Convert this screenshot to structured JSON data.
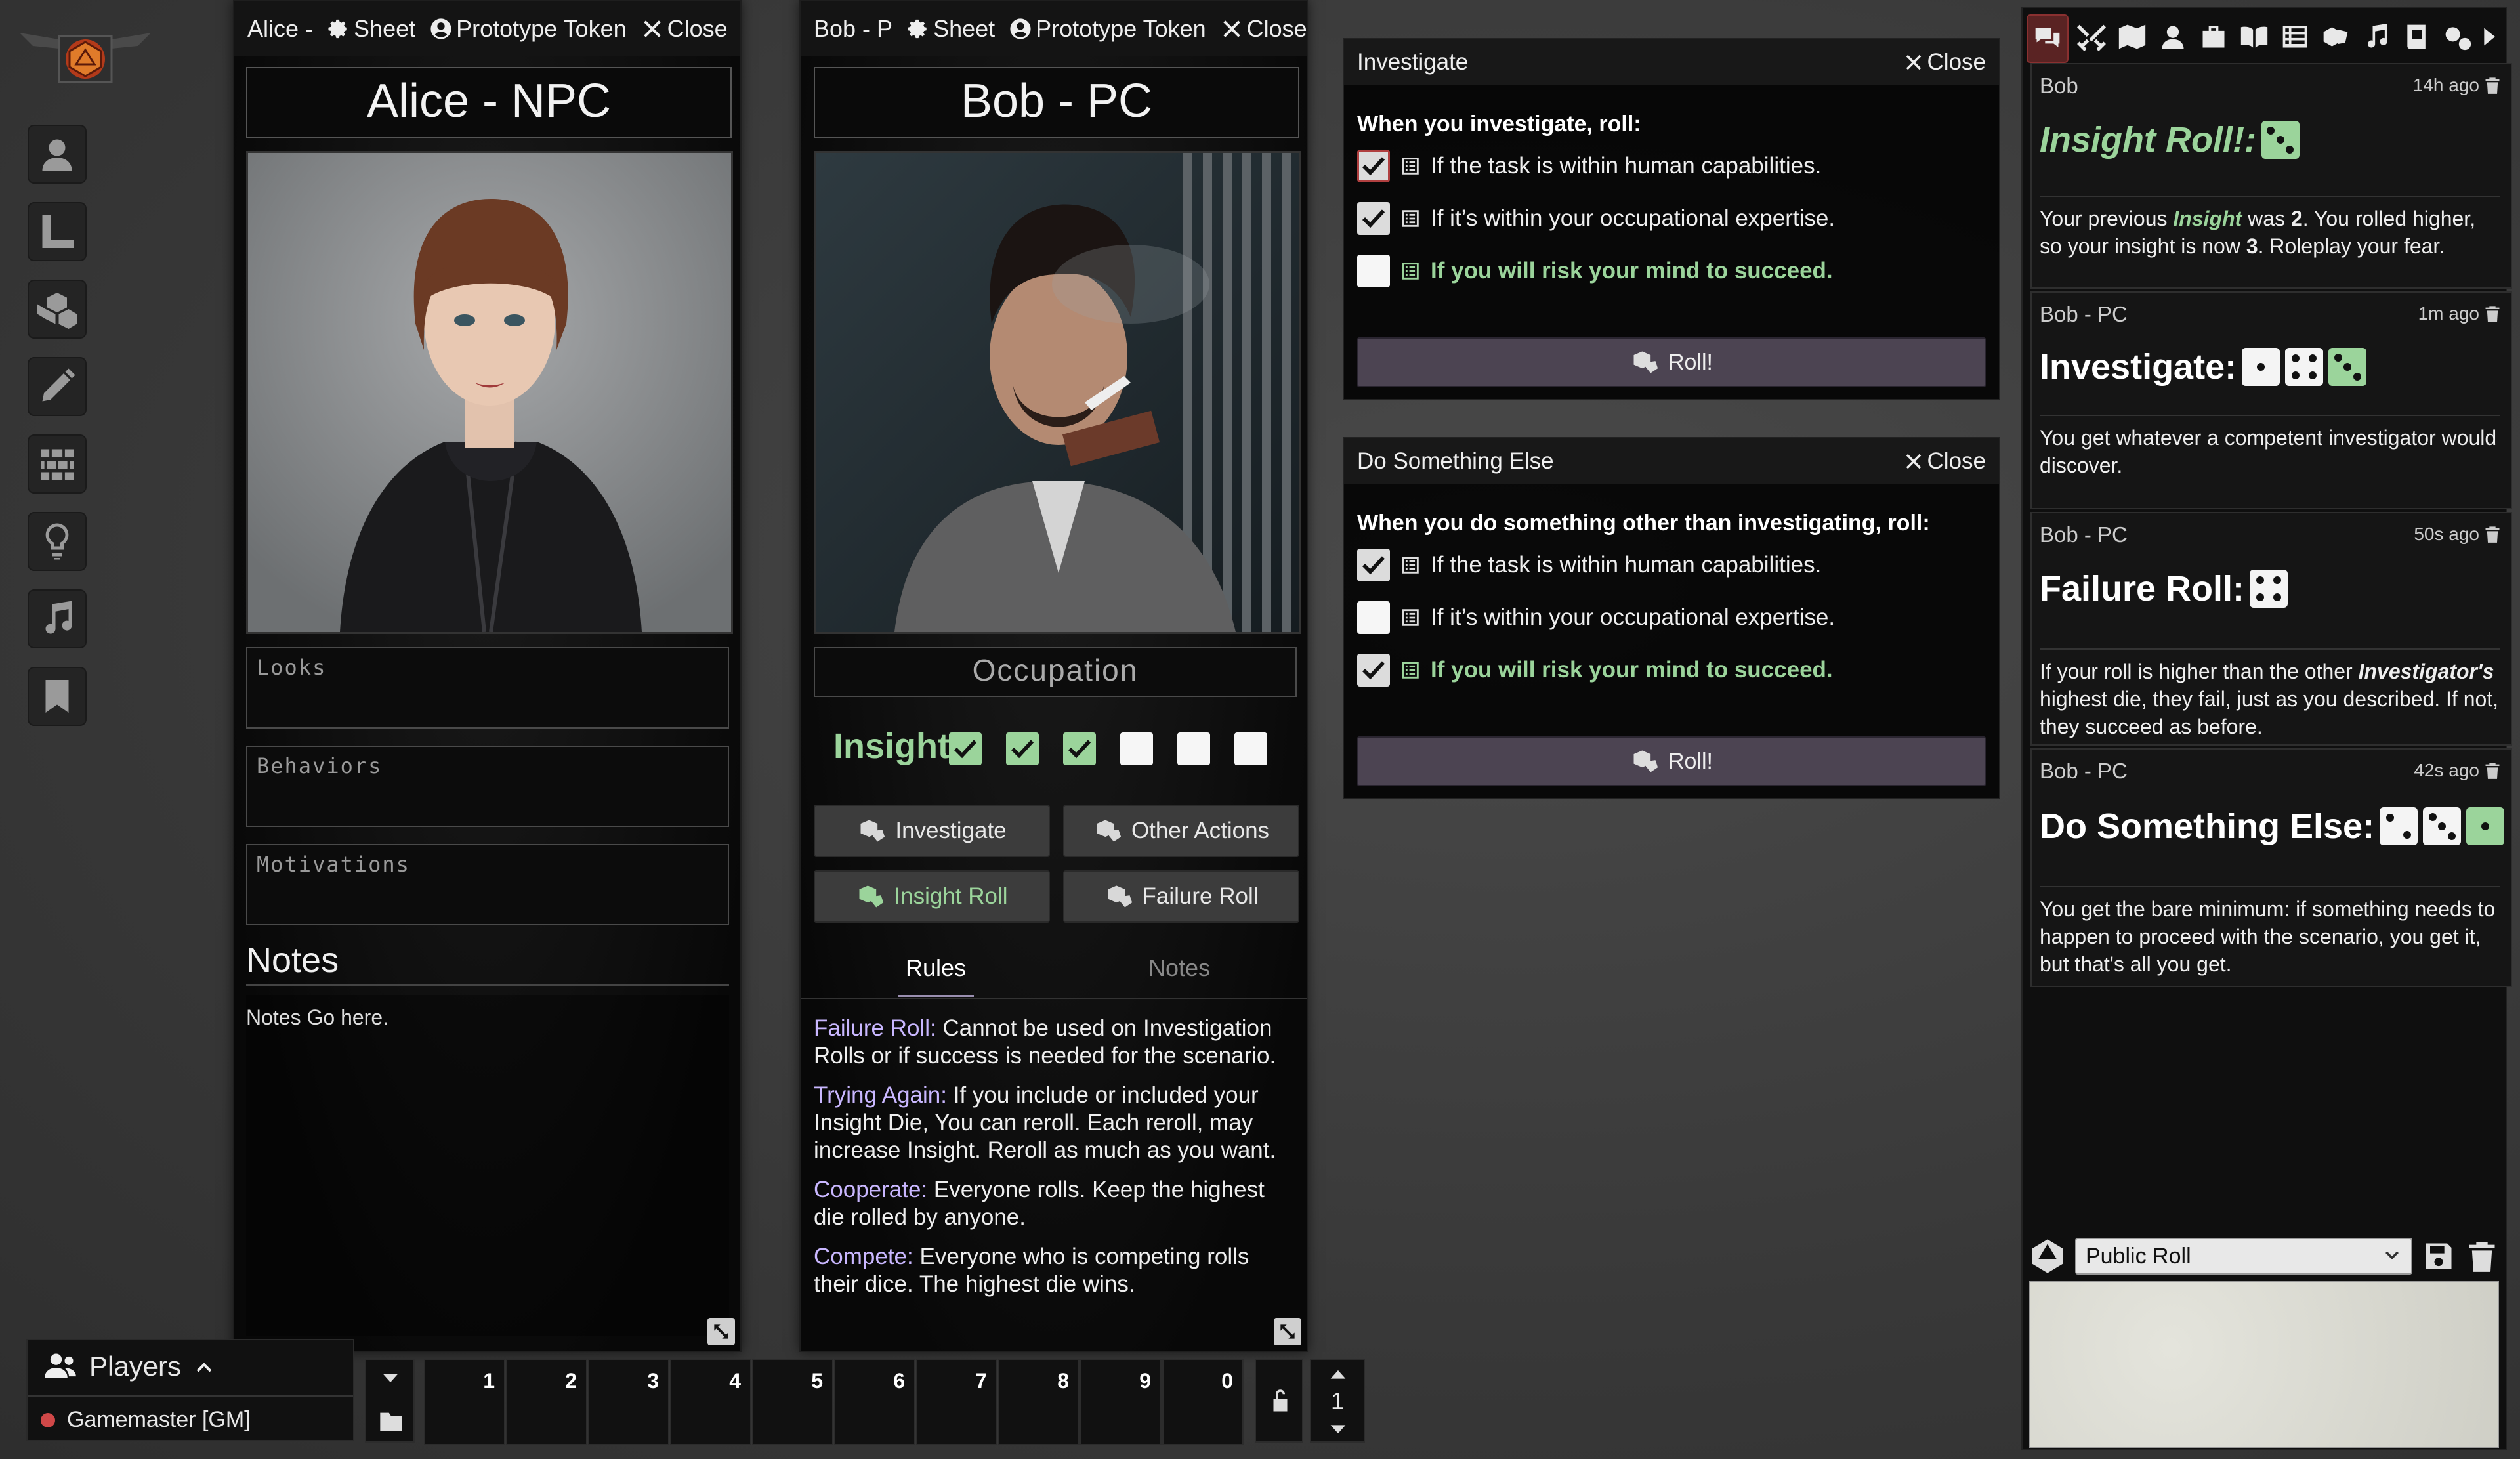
{
  "sidebar_tools": [
    "user-icon",
    "ruler-icon",
    "dice-cubes-icon",
    "pencil-icon",
    "wall-icon",
    "lightbulb-icon",
    "music-note-icon",
    "bookmark-icon"
  ],
  "alice": {
    "header_title": "Alice -",
    "sheet_label": "Sheet",
    "token_label": "Prototype Token",
    "close_label": "Close",
    "name": "Alice - NPC",
    "looks_placeholder": "Looks",
    "behaviors_placeholder": "Behaviors",
    "motivations_placeholder": "Motivations",
    "notes_title": "Notes",
    "notes_text": "Notes Go here."
  },
  "bob": {
    "header_title": "Bob - P",
    "sheet_label": "Sheet",
    "token_label": "Prototype Token",
    "close_label": "Close",
    "name": "Bob - PC",
    "occupation_placeholder": "Occupation",
    "insight_label": "Insight",
    "insight_boxes": [
      true,
      true,
      true,
      false,
      false,
      false
    ],
    "buttons": {
      "investigate": "Investigate",
      "other_actions": "Other Actions",
      "insight_roll": "Insight Roll",
      "failure_roll": "Failure Roll"
    },
    "tabs": {
      "rules": "Rules",
      "notes": "Notes"
    },
    "rules": [
      {
        "term": "Failure Roll:",
        "text": " Cannot be used on Investigation Rolls or if success is needed for the scenario."
      },
      {
        "term": "Trying Again:",
        "text": " If you include or included your Insight Die, You can reroll. Each reroll, may increase Insight. Reroll as much as you want."
      },
      {
        "term": "Cooperate:",
        "text": " Everyone rolls. Keep the highest die rolled by anyone."
      },
      {
        "term": "Compete:",
        "text": " Everyone who is competing rolls their dice. The highest die wins."
      }
    ]
  },
  "investigate_dialog": {
    "title": "Investigate",
    "close_label": "Close",
    "prompt": "When you investigate, roll:",
    "options": [
      {
        "label": "If the task is within human capabilities.",
        "checked": true,
        "highlight": false
      },
      {
        "label": "If it’s within your occupational expertise.",
        "checked": true,
        "highlight": false
      },
      {
        "label": "If you will risk your mind to succeed.",
        "checked": false,
        "highlight": true
      }
    ],
    "roll_label": "Roll!"
  },
  "other_dialog": {
    "title": "Do Something Else",
    "close_label": "Close",
    "prompt": "When you do something other than investigating, roll:",
    "options": [
      {
        "label": "If the task is within human capabilities.",
        "checked": true,
        "highlight": false
      },
      {
        "label": "If it’s within your occupational expertise.",
        "checked": false,
        "highlight": false
      },
      {
        "label": "If you will risk your mind to succeed.",
        "checked": true,
        "highlight": true
      }
    ],
    "roll_label": "Roll!"
  },
  "chat": {
    "messages": [
      {
        "speaker": "Bob",
        "time": "14h ago",
        "flavor": "Insight Roll!:",
        "dice": [
          {
            "face": 3,
            "green": true
          }
        ],
        "text_html": "Your previous <b><i style='color:#9bd49b'>Insight</i></b> was <b>2</b>. You rolled higher, so your insight is now <b>3</b>. Roleplay your fear."
      },
      {
        "speaker": "Bob - PC",
        "time": "1m ago",
        "flavor": "Investigate:",
        "dice": [
          {
            "face": 1,
            "green": false
          },
          {
            "face": 4,
            "green": false
          },
          {
            "face": 3,
            "green": true
          }
        ],
        "text_html": "You get whatever a competent investigator would discover."
      },
      {
        "speaker": "Bob - PC",
        "time": "50s ago",
        "flavor": "Failure Roll:",
        "dice": [
          {
            "face": 4,
            "green": false
          }
        ],
        "text_html": "If your roll is higher than the other <b><i>Investigator's</i></b> highest die, they fail, just as you described. If not, they succeed as before."
      },
      {
        "speaker": "Bob - PC",
        "time": "42s ago",
        "flavor": "Do Something Else:",
        "dice": [
          {
            "face": 2,
            "green": false
          },
          {
            "face": 3,
            "green": false
          },
          {
            "face": 1,
            "green": true
          }
        ],
        "text_html": "You get the bare minimum: if something needs to happen to proceed with the scenario, you get it, but that's all you get."
      }
    ],
    "roll_mode": "Public Roll"
  },
  "players": {
    "title": "Players",
    "entries": [
      "Gamemaster [GM]"
    ]
  },
  "hotbar": {
    "slots": [
      "1",
      "2",
      "3",
      "4",
      "5",
      "6",
      "7",
      "8",
      "9",
      "0"
    ],
    "page": "1"
  }
}
